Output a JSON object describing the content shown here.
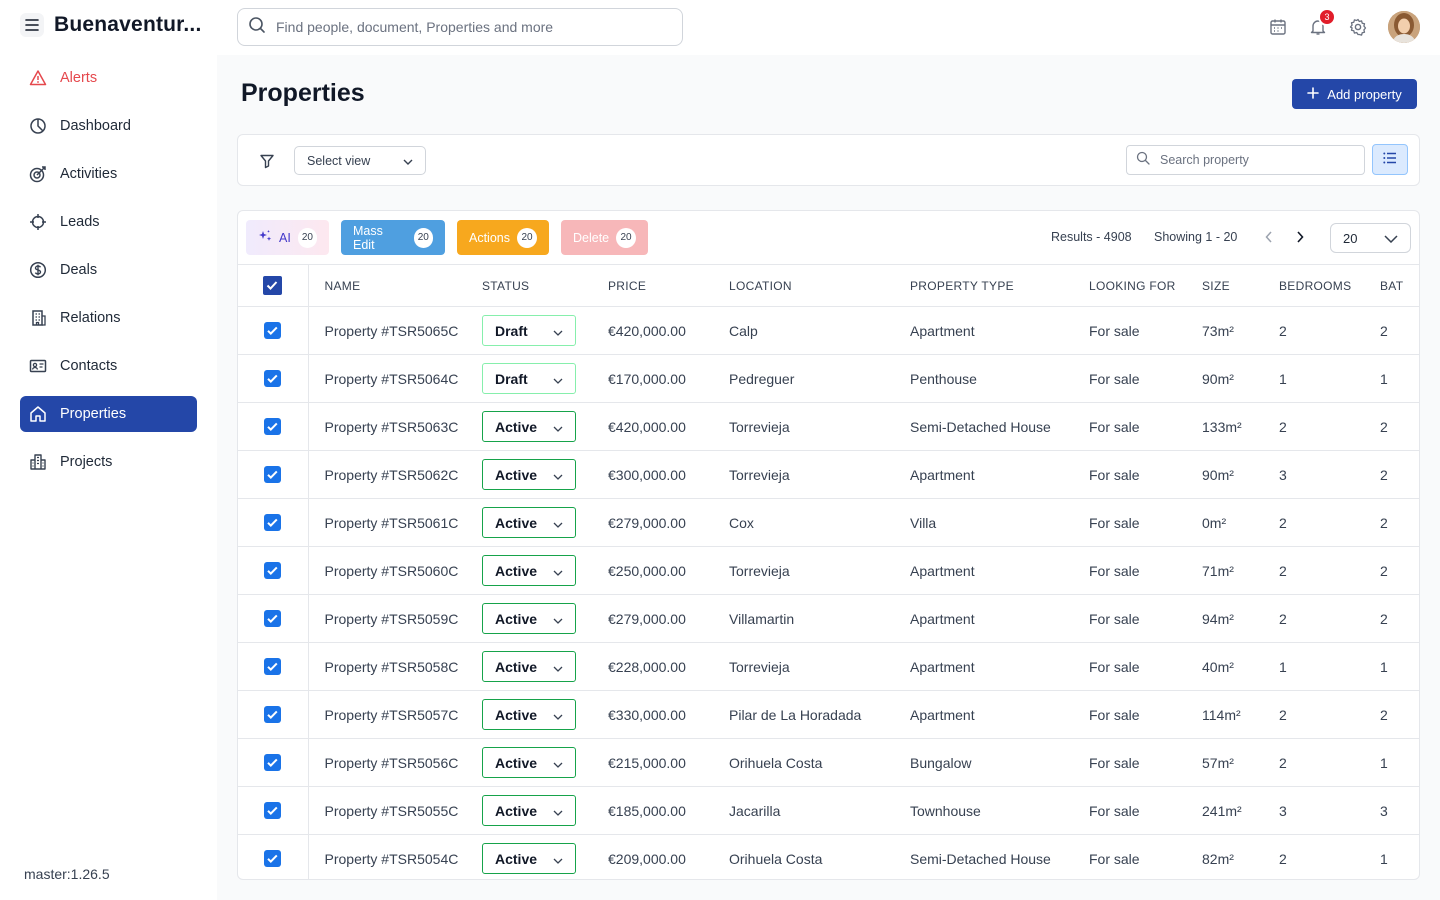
{
  "app": {
    "brand": "Buenaventur..."
  },
  "topbar": {
    "search_placeholder": "Find people, document, Properties and more",
    "notifications_count": "3"
  },
  "sidebar": {
    "items": [
      {
        "label": "Alerts",
        "icon": "alert-triangle-icon"
      },
      {
        "label": "Dashboard",
        "icon": "pie-chart-icon"
      },
      {
        "label": "Activities",
        "icon": "target-icon"
      },
      {
        "label": "Leads",
        "icon": "crosshair-icon"
      },
      {
        "label": "Deals",
        "icon": "dollar-icon"
      },
      {
        "label": "Relations",
        "icon": "building-icon"
      },
      {
        "label": "Contacts",
        "icon": "id-card-icon"
      },
      {
        "label": "Properties",
        "icon": "home-icon"
      },
      {
        "label": "Projects",
        "icon": "city-icon"
      }
    ],
    "active": "Properties",
    "version": "master:1.26.5"
  },
  "page": {
    "title": "Properties",
    "add_label": "Add property"
  },
  "filters": {
    "select_view": "Select view",
    "search_placeholder": "Search property"
  },
  "bulk": {
    "ai_label": "AI",
    "ai_count": "20",
    "mass_label": "Mass Edit",
    "mass_count": "20",
    "actions_label": "Actions",
    "actions_count": "20",
    "delete_label": "Delete",
    "delete_count": "20"
  },
  "pagination": {
    "results": "Results - 4908",
    "showing": "Showing 1 - 20",
    "page_size": "20"
  },
  "table": {
    "columns": [
      "NAME",
      "STATUS",
      "PRICE",
      "LOCATION",
      "PROPERTY TYPE",
      "LOOKING FOR",
      "SIZE",
      "BEDROOMS",
      "BAT"
    ],
    "rows": [
      {
        "name": "Property #TSR5065C",
        "status": "Draft",
        "price": "€420,000.00",
        "location": "Calp",
        "type": "Apartment",
        "looking": "For sale",
        "size": "73m²",
        "bedrooms": "2",
        "bath": "2"
      },
      {
        "name": "Property #TSR5064C",
        "status": "Draft",
        "price": "€170,000.00",
        "location": "Pedreguer",
        "type": "Penthouse",
        "looking": "For sale",
        "size": "90m²",
        "bedrooms": "1",
        "bath": "1"
      },
      {
        "name": "Property #TSR5063C",
        "status": "Active",
        "price": "€420,000.00",
        "location": "Torrevieja",
        "type": "Semi-Detached House",
        "looking": "For sale",
        "size": "133m²",
        "bedrooms": "2",
        "bath": "2"
      },
      {
        "name": "Property #TSR5062C",
        "status": "Active",
        "price": "€300,000.00",
        "location": "Torrevieja",
        "type": "Apartment",
        "looking": "For sale",
        "size": "90m²",
        "bedrooms": "3",
        "bath": "2"
      },
      {
        "name": "Property #TSR5061C",
        "status": "Active",
        "price": "€279,000.00",
        "location": "Cox",
        "type": "Villa",
        "looking": "For sale",
        "size": "0m²",
        "bedrooms": "2",
        "bath": "2"
      },
      {
        "name": "Property #TSR5060C",
        "status": "Active",
        "price": "€250,000.00",
        "location": "Torrevieja",
        "type": "Apartment",
        "looking": "For sale",
        "size": "71m²",
        "bedrooms": "2",
        "bath": "2"
      },
      {
        "name": "Property #TSR5059C",
        "status": "Active",
        "price": "€279,000.00",
        "location": "Villamartin",
        "type": "Apartment",
        "looking": "For sale",
        "size": "94m²",
        "bedrooms": "2",
        "bath": "2"
      },
      {
        "name": "Property #TSR5058C",
        "status": "Active",
        "price": "€228,000.00",
        "location": "Torrevieja",
        "type": "Apartment",
        "looking": "For sale",
        "size": "40m²",
        "bedrooms": "1",
        "bath": "1"
      },
      {
        "name": "Property #TSR5057C",
        "status": "Active",
        "price": "€330,000.00",
        "location": "Pilar de La Horadada",
        "type": "Apartment",
        "looking": "For sale",
        "size": "114m²",
        "bedrooms": "2",
        "bath": "2"
      },
      {
        "name": "Property #TSR5056C",
        "status": "Active",
        "price": "€215,000.00",
        "location": "Orihuela Costa",
        "type": "Bungalow",
        "looking": "For sale",
        "size": "57m²",
        "bedrooms": "2",
        "bath": "1"
      },
      {
        "name": "Property #TSR5055C",
        "status": "Active",
        "price": "€185,000.00",
        "location": "Jacarilla",
        "type": "Townhouse",
        "looking": "For sale",
        "size": "241m²",
        "bedrooms": "3",
        "bath": "3"
      },
      {
        "name": "Property #TSR5054C",
        "status": "Active",
        "price": "€209,000.00",
        "location": "Orihuela Costa",
        "type": "Semi-Detached House",
        "looking": "For sale",
        "size": "82m²",
        "bedrooms": "2",
        "bath": "1"
      }
    ]
  },
  "colors": {
    "primary": "#2447a8",
    "alert": "#e5484d",
    "mass_edit": "#4f9fe0",
    "actions": "#f7a81e",
    "delete": "#f7b7b9",
    "active_status": "#16a34a",
    "draft_status": "#86efac"
  }
}
